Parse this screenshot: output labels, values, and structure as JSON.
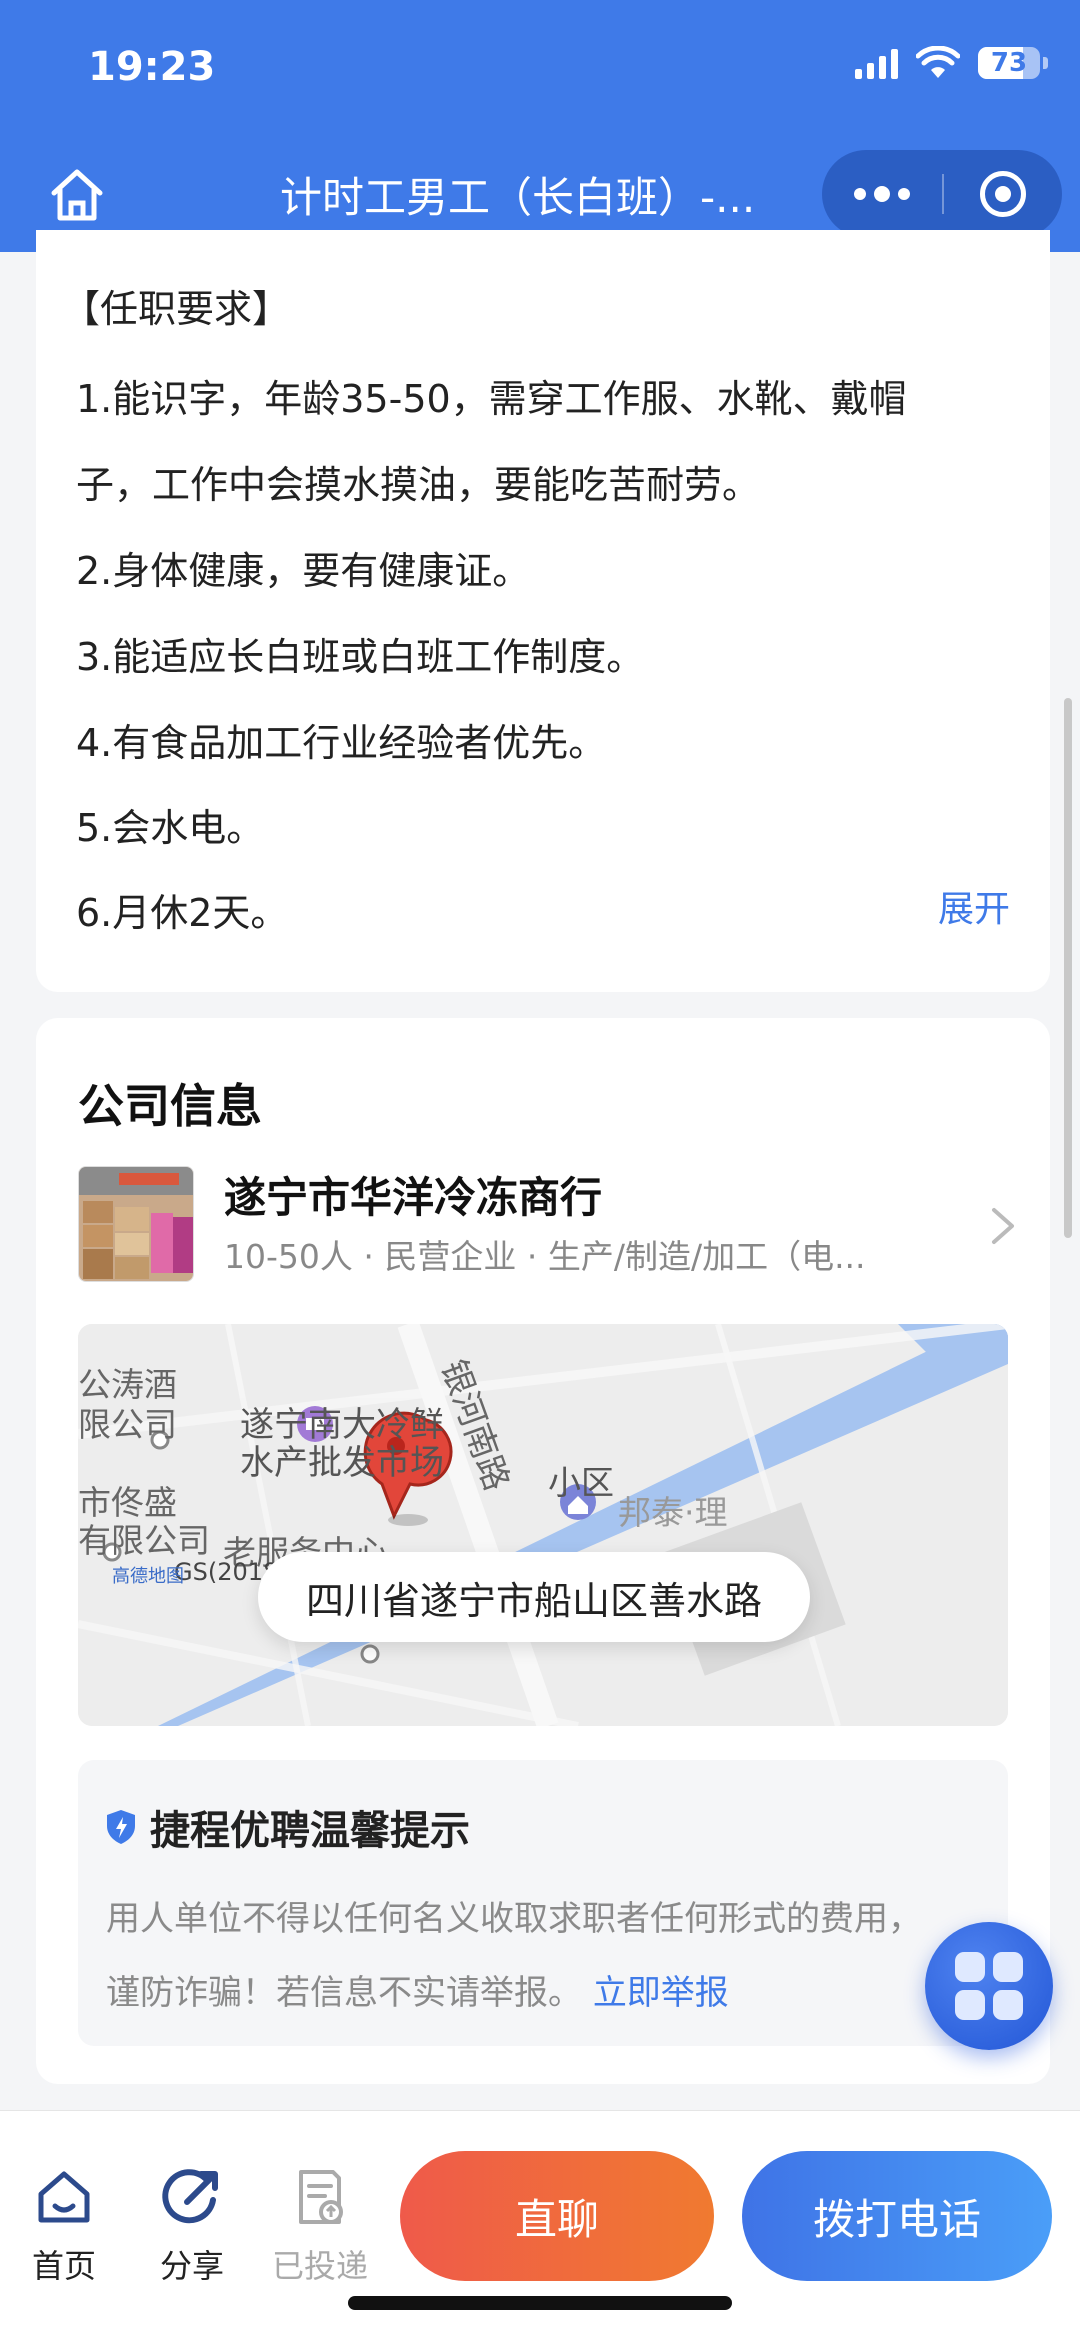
{
  "status_bar": {
    "time": "19:23",
    "battery": "73"
  },
  "navbar": {
    "title": "计时工男工（长白班）-..."
  },
  "requirements": {
    "heading": "【任职要求】",
    "lines": [
      "1.能识字，年龄35-50，需穿工作服、水靴、戴帽",
      "子，工作中会摸水摸油，要能吃苦耐劳。",
      "2.身体健康，要有健康证。",
      "3.能适应长白班或白班工作制度。",
      "4.有食品加工行业经验者优先。",
      "5.会水电。",
      "6.月休2天。"
    ],
    "expand_label": "展开"
  },
  "company": {
    "section_title": "公司信息",
    "name": "遂宁市华洋冷冻商行",
    "meta": "10-50人 · 民营企业 · 生产/制造/加工（电...",
    "map": {
      "address": "四川省遂宁市船山区善水路",
      "labels": {
        "market_line1": "遂宁南大冷鲜",
        "market_line2": "水产批发市场",
        "road": "银河南路",
        "a_line1": "公涛酒",
        "a_line2": "限公司",
        "b_line1": "市佟盛",
        "b_line2": "有限公司",
        "service": "老服务中心",
        "bangtai": "邦泰·理",
        "district": "小区",
        "gs": "GS(2018)1709号",
        "provider": "高德地图"
      }
    }
  },
  "tip": {
    "title": "捷程优聘温馨提示",
    "line1": "用人单位不得以任何名义收取求职者任何形式的费用，",
    "line2": "谨防诈骗！若信息不实请举报。",
    "report_link": "立即举报"
  },
  "bottom_bar": {
    "home": "首页",
    "share": "分享",
    "applied": "已投递",
    "chat_button": "直聊",
    "call_button": "拨打电话"
  },
  "colors": {
    "brand_blue": "#3f7ae8",
    "chat_gradient": [
      "#ef5a4a",
      "#f07a30"
    ],
    "call_gradient": [
      "#3f73e6",
      "#4a9ef8"
    ]
  }
}
